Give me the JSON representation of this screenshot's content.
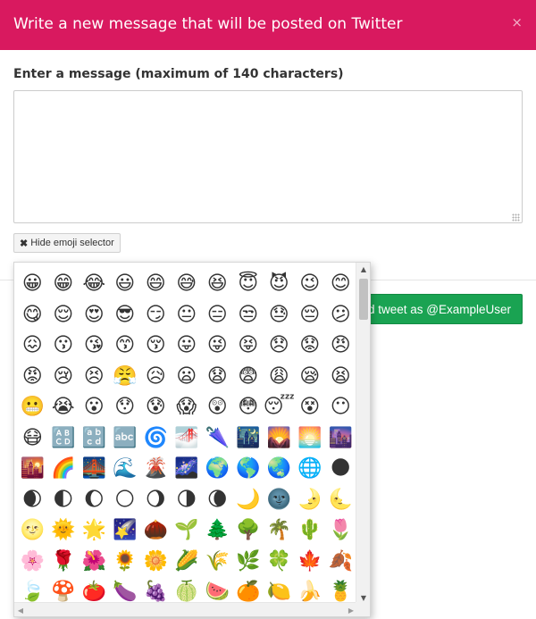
{
  "header": {
    "title": "Write a new message that will be posted on Twitter",
    "close_symbol": "×"
  },
  "form": {
    "label": "Enter a message (maximum of 140 characters)",
    "message_value": "",
    "hide_button_icon": "✖",
    "hide_button_label": "Hide emoji selector",
    "tweet_button_label": "Send tweet as @ExampleUser"
  },
  "colors": {
    "header_bg": "#d9195f",
    "tweet_button_bg": "#1aa352"
  },
  "emoji_selector": {
    "emojis": [
      "😀",
      "😁",
      "😂",
      "😃",
      "😄",
      "😅",
      "😆",
      "😇",
      "😈",
      "😉",
      "😊",
      "😋",
      "😌",
      "😍",
      "😎",
      "😏",
      "😐",
      "😑",
      "😒",
      "😓",
      "😔",
      "😕",
      "😖",
      "😗",
      "😘",
      "😙",
      "😚",
      "😛",
      "😜",
      "😝",
      "😞",
      "😟",
      "😠",
      "😡",
      "😢",
      "😣",
      "😤",
      "😥",
      "😦",
      "😧",
      "😨",
      "😩",
      "😪",
      "😫",
      "😬",
      "😭",
      "😮",
      "😯",
      "😰",
      "😱",
      "😲",
      "😳",
      "😴",
      "😵",
      "😶",
      "😷",
      "🔠",
      "🔡",
      "🔤",
      "🌀",
      "🌁",
      "🌂",
      "🌃",
      "🌄",
      "🌅",
      "🌆",
      "🌇",
      "🌈",
      "🌉",
      "🌊",
      "🌋",
      "🌌",
      "🌍",
      "🌎",
      "🌏",
      "🌐",
      "🌑",
      "🌒",
      "🌓",
      "🌔",
      "🌕",
      "🌖",
      "🌗",
      "🌘",
      "🌙",
      "🌚",
      "🌛",
      "🌜",
      "🌝",
      "🌞",
      "🌟",
      "🌠",
      "🌰",
      "🌱",
      "🌲",
      "🌳",
      "🌴",
      "🌵",
      "🌷",
      "🌸",
      "🌹",
      "🌺",
      "🌻",
      "🌼",
      "🌽",
      "🌾",
      "🌿",
      "🍀",
      "🍁",
      "🍂",
      "🍃",
      "🍄",
      "🍅",
      "🍆",
      "🍇",
      "🍈",
      "🍉",
      "🍊",
      "🍋",
      "🍌",
      "🍍",
      "🍎",
      "🍏",
      "🍐",
      "🍑",
      "🍒",
      "🍓",
      "🍔",
      "🍕",
      "🍖",
      "🍗",
      "🍘"
    ],
    "scroll_up_icon": "▲",
    "scroll_down_icon": "▼",
    "scroll_left_icon": "◀",
    "scroll_right_icon": "▶"
  }
}
